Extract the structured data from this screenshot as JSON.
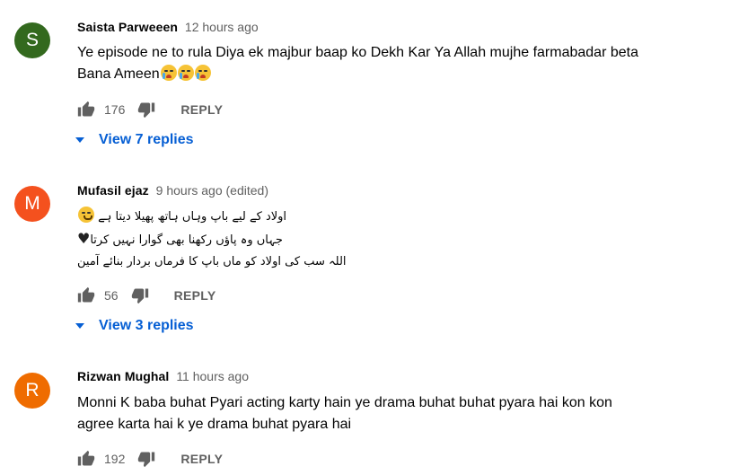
{
  "comments": [
    {
      "initial": "S",
      "avatar_color": "#33691e",
      "author": "Saista Parweeen",
      "time": "12 hours ago",
      "text_lines": [
        "Ye episode ne to rula Diya ek majbur baap ko Dekh Kar Ya Allah mujhe farmabadar beta",
        "Bana Ameen"
      ],
      "emojis": [
        "loudly-crying-face",
        "loudly-crying-face",
        "loudly-crying-face"
      ],
      "likes": "176",
      "reply_label": "REPLY",
      "view_replies": "View 7 replies"
    },
    {
      "initial": "M",
      "avatar_color": "#f4511e",
      "author": "Mufasil ejaz",
      "time": "9 hours ago (edited)",
      "text_lines": [
        "اولاد کے لیے باپ وہاں ہاتھ پھیلا دیتا ہے",
        "جہاں وہ پاؤں رکھنا بھی گوارا نہیں کرتا",
        "اللہ سب کی اولاد کو ماں باپ کا فرماں بردار بنائے آمین"
      ],
      "emojis": [
        "upside-down-face",
        "black-heart"
      ],
      "likes": "56",
      "reply_label": "REPLY",
      "view_replies": "View 3 replies"
    },
    {
      "initial": "R",
      "avatar_color": "#ef6c00",
      "author": "Rizwan Mughal",
      "time": "11 hours ago",
      "text_lines": [
        "Monni K baba buhat Pyari acting karty hain ye drama buhat buhat pyara hai kon kon",
        "agree karta hai k ye drama buhat pyara hai"
      ],
      "likes": "192",
      "reply_label": "REPLY"
    }
  ],
  "icons": {
    "like": "thumbs-up-icon",
    "dislike": "thumbs-down-icon",
    "expand": "caret-down-icon"
  },
  "colors": {
    "link": "#065fd4",
    "secondary_text": "#606060"
  }
}
